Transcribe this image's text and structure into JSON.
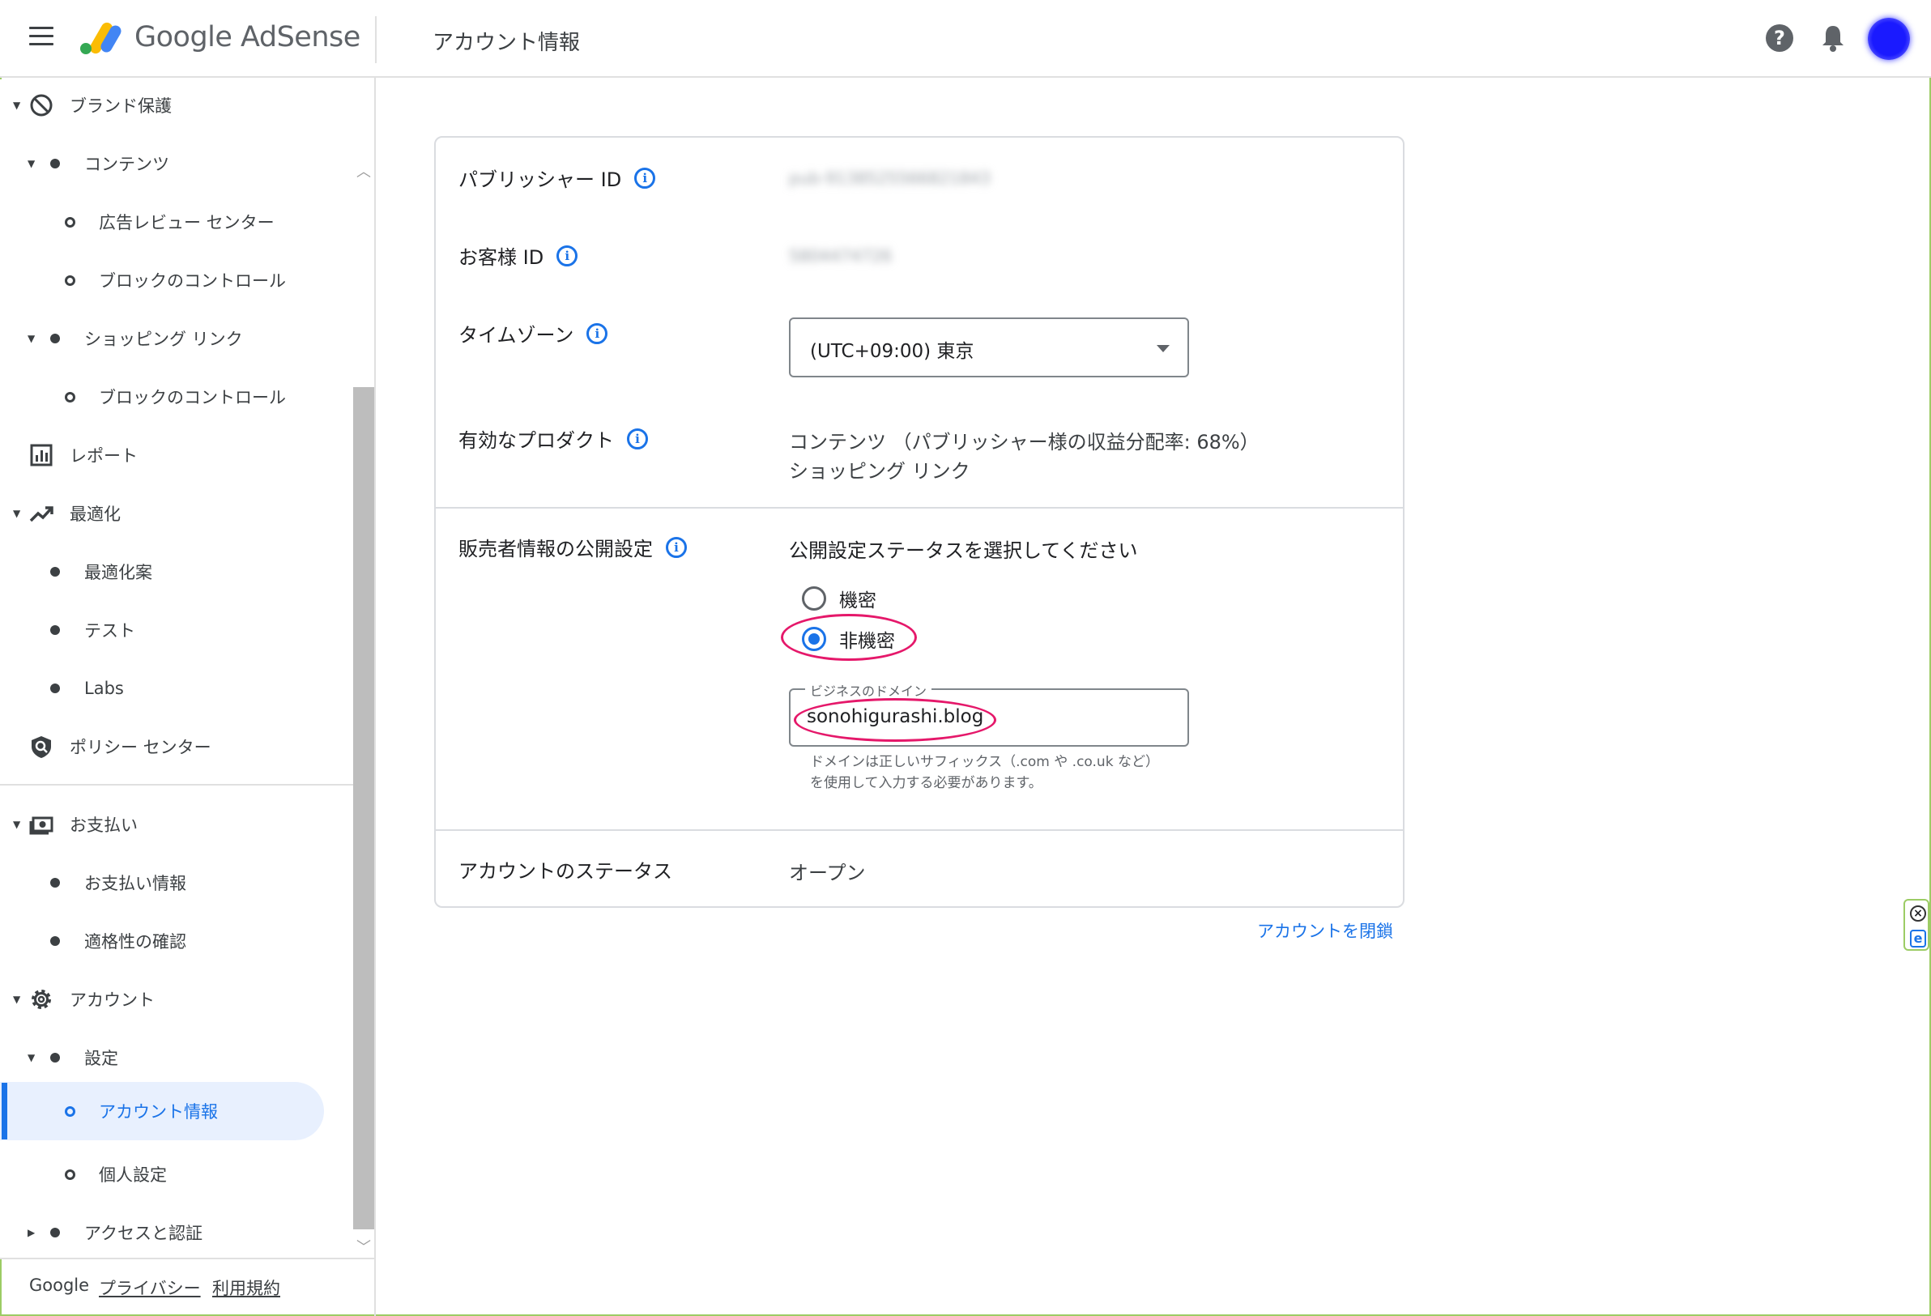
{
  "header": {
    "app_name": "Google AdSense",
    "page_title": "アカウント情報",
    "help_icon_glyph": "?"
  },
  "sidebar": {
    "items": [
      {
        "label": "ブランド保護",
        "icon": "block-icon"
      },
      {
        "label": "コンテンツ"
      },
      {
        "label": "広告レビュー センター"
      },
      {
        "label": "ブロックのコントロール"
      },
      {
        "label": "ショッピング リンク"
      },
      {
        "label": "ブロックのコントロール"
      },
      {
        "label": "レポート",
        "icon": "bar-chart-icon"
      },
      {
        "label": "最適化",
        "icon": "trending-up-icon"
      },
      {
        "label": "最適化案"
      },
      {
        "label": "テスト"
      },
      {
        "label": "Labs"
      },
      {
        "label": "ポリシー センター",
        "icon": "policy-shield-icon"
      },
      {
        "label": "お支払い",
        "icon": "payments-icon"
      },
      {
        "label": "お支払い情報"
      },
      {
        "label": "適格性の確認"
      },
      {
        "label": "アカウント",
        "icon": "gear-icon"
      },
      {
        "label": "設定"
      },
      {
        "label": "アカウント情報"
      },
      {
        "label": "個人設定"
      },
      {
        "label": "アクセスと認証"
      }
    ],
    "footer": {
      "brand": "Google",
      "privacy": "プライバシー",
      "terms": "利用規約"
    }
  },
  "account": {
    "publisher_id_label": "パブリッシャー ID",
    "publisher_id_value": "pub-9138525566821843",
    "customer_id_label": "お客様 ID",
    "customer_id_value": "5804474726",
    "timezone_label": "タイムゾーン",
    "timezone_value": "(UTC+09:00) 東京",
    "products_label": "有効なプロダクト",
    "products_line1": "コンテンツ （パブリッシャー様の収益分配率: 68%）",
    "products_line2": "ショッピング リンク",
    "seller_label": "販売者情報の公開設定",
    "seller_prompt": "公開設定ステータスを選択してください",
    "radio_confidential": "機密",
    "radio_non_confidential": "非機密",
    "selected_option": "非機密",
    "domain_field_label": "ビジネスのドメイン",
    "domain_value": "sonohigurashi.blog",
    "domain_hint": "ドメインは正しいサフィックス（.com や .co.uk など）を使用して入力する必要があります。",
    "status_label": "アカウントのステータス",
    "status_value": "オープン",
    "close_account": "アカウントを閉鎖",
    "info_glyph": "i"
  },
  "colors": {
    "accent": "#1a73e8",
    "highlight": "#e5186a"
  }
}
